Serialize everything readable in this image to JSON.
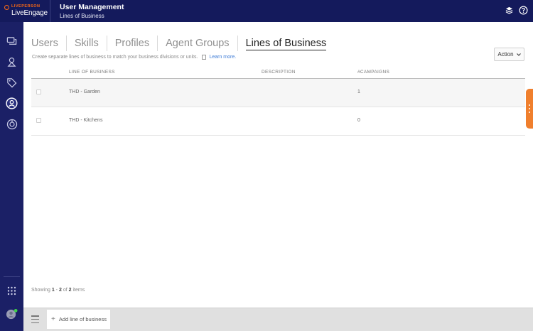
{
  "header": {
    "logo_top": "LIVEPERSON",
    "logo_main": "LiveEngage",
    "title": "User Management",
    "subtitle": "Lines of Business",
    "icons": [
      "layers-icon",
      "help-icon"
    ]
  },
  "sidebar": {
    "items": [
      {
        "name": "conversations-icon",
        "active": false
      },
      {
        "name": "campaigns-icon",
        "active": false
      },
      {
        "name": "tags-icon",
        "active": false
      },
      {
        "name": "users-icon",
        "active": true
      },
      {
        "name": "analytics-icon",
        "active": false
      }
    ],
    "bottom": [
      "apps-grid-icon",
      "user-avatar"
    ]
  },
  "tabs": [
    {
      "label": "Users",
      "active": false
    },
    {
      "label": "Skills",
      "active": false
    },
    {
      "label": "Profiles",
      "active": false
    },
    {
      "label": "Agent Groups",
      "active": false
    },
    {
      "label": "Lines of Business",
      "active": true
    }
  ],
  "description": {
    "text": "Create separate lines of business to match your business divisions or units.",
    "link": "Learn more."
  },
  "action_button": {
    "label": "Action"
  },
  "table": {
    "columns": [
      "LINE OF BUSINESS",
      "DESCRIPTION",
      "#CAMPAIGNS"
    ],
    "rows": [
      {
        "name": "THD - Garden",
        "description": "",
        "campaigns": "1"
      },
      {
        "name": "THD - Kitchens",
        "description": "",
        "campaigns": "0"
      }
    ]
  },
  "pagination": {
    "prefix": "Showing",
    "from": "1",
    "dash": "-",
    "to": "2",
    "of": "of",
    "total": "2",
    "suffix": "items"
  },
  "bottom": {
    "add_label": "Add line of business"
  },
  "colors": {
    "header_bg": "#141a5c",
    "sidebar_bg": "#1b2066",
    "accent": "#f07f2d",
    "link": "#3c7bd6"
  }
}
